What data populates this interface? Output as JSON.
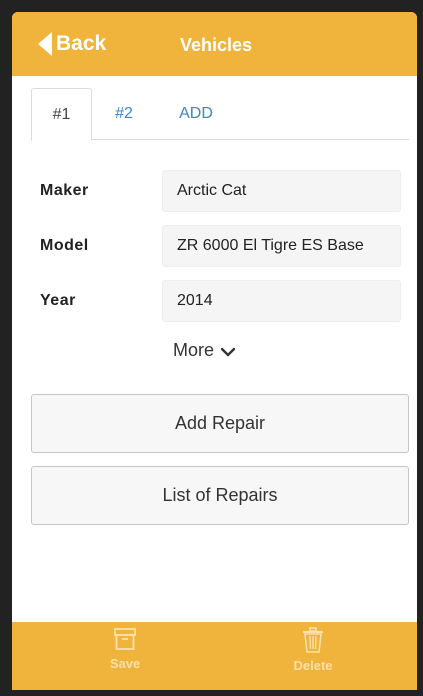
{
  "header": {
    "back_label": "Back",
    "title": "Vehicles"
  },
  "tabs": [
    {
      "label": "#1",
      "active": true
    },
    {
      "label": "#2",
      "active": false
    },
    {
      "label": "ADD",
      "active": false
    }
  ],
  "fields": [
    {
      "label": "Maker",
      "value": "Arctic Cat"
    },
    {
      "label": "Model",
      "value": "ZR 6000 El Tigre ES Base"
    },
    {
      "label": "Year",
      "value": "2014"
    }
  ],
  "more_label": "More",
  "buttons": {
    "add_repair": "Add Repair",
    "list_repairs": "List of Repairs"
  },
  "footer": {
    "save_label": "Save",
    "delete_label": "Delete"
  },
  "colors": {
    "accent": "#f0b43c",
    "tab_link": "#3b86c6",
    "footer_icon": "#fbe0a8"
  },
  "icons": {
    "back": "back-arrow-icon",
    "more": "chevron-down-icon",
    "save": "archive-box-icon",
    "delete": "trash-icon"
  }
}
